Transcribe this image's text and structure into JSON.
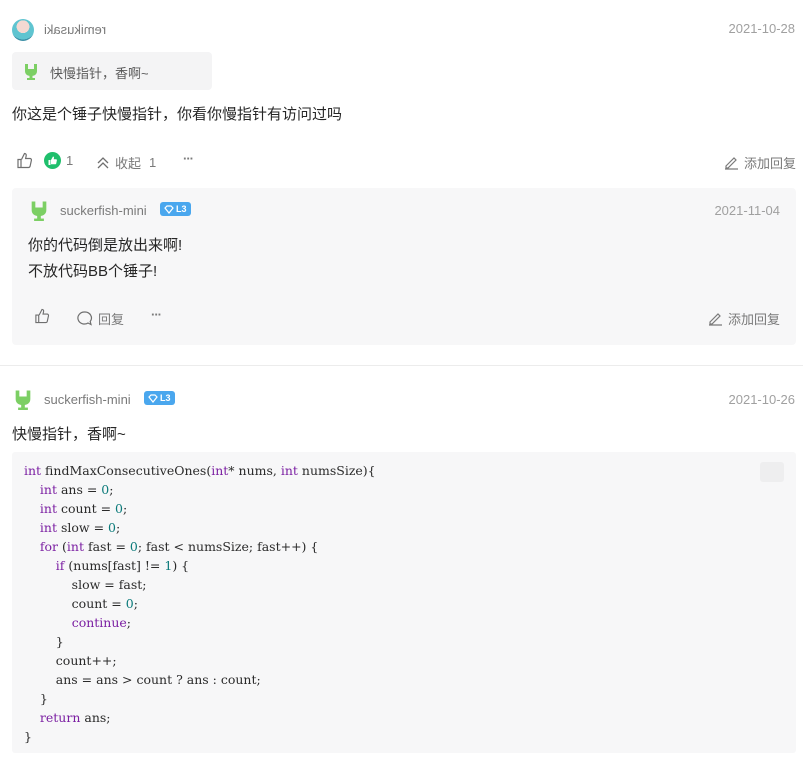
{
  "comment1": {
    "username": "remikusaki",
    "date": "2021-10-28",
    "quote_text": "快慢指针，香啊~",
    "body": "你这是个锤子快慢指针，你看你慢指针有访问过吗",
    "like_count": "1",
    "collapse_label": "收起",
    "collapse_count": "1",
    "more_label": "···",
    "add_reply_label": "添加回复"
  },
  "reply1": {
    "username": "suckerfish-mini",
    "level": "L3",
    "date": "2021-11-04",
    "line1": "你的代码倒是放出来啊!",
    "line2": "不放代码BB个锤子!",
    "reply_label": "回复",
    "more_label": "···",
    "add_reply_label": "添加回复"
  },
  "comment2": {
    "username": "suckerfish-mini",
    "level": "L3",
    "date": "2021-10-26",
    "body": "快慢指针，香啊~",
    "code_lines": [
      [
        {
          "t": "int",
          "c": "kw"
        },
        {
          "t": " findMaxConsecutiveOnes("
        },
        {
          "t": "int",
          "c": "kw"
        },
        {
          "t": "* nums, "
        },
        {
          "t": "int",
          "c": "kw"
        },
        {
          "t": " numsSize){"
        }
      ],
      [
        {
          "t": "    "
        },
        {
          "t": "int",
          "c": "kw"
        },
        {
          "t": " ans = "
        },
        {
          "t": "0",
          "c": "num"
        },
        {
          "t": ";"
        }
      ],
      [
        {
          "t": "    "
        },
        {
          "t": "int",
          "c": "kw"
        },
        {
          "t": " count = "
        },
        {
          "t": "0",
          "c": "num"
        },
        {
          "t": ";"
        }
      ],
      [
        {
          "t": "    "
        },
        {
          "t": "int",
          "c": "kw"
        },
        {
          "t": " slow = "
        },
        {
          "t": "0",
          "c": "num"
        },
        {
          "t": ";"
        }
      ],
      [
        {
          "t": "    "
        },
        {
          "t": "for",
          "c": "kw"
        },
        {
          "t": " ("
        },
        {
          "t": "int",
          "c": "kw"
        },
        {
          "t": " fast = "
        },
        {
          "t": "0",
          "c": "num"
        },
        {
          "t": "; fast < numsSize; fast++) {"
        }
      ],
      [
        {
          "t": "        "
        },
        {
          "t": "if",
          "c": "kw"
        },
        {
          "t": " (nums[fast] != "
        },
        {
          "t": "1",
          "c": "num"
        },
        {
          "t": ") {"
        }
      ],
      [
        {
          "t": "            slow = fast;"
        }
      ],
      [
        {
          "t": "            count = "
        },
        {
          "t": "0",
          "c": "num"
        },
        {
          "t": ";"
        }
      ],
      [
        {
          "t": "            "
        },
        {
          "t": "continue",
          "c": "kw"
        },
        {
          "t": ";"
        }
      ],
      [
        {
          "t": "        }"
        }
      ],
      [
        {
          "t": "        count++;"
        }
      ],
      [
        {
          "t": "        ans = ans > count ? ans : count;"
        }
      ],
      [
        {
          "t": "    }"
        }
      ],
      [
        {
          "t": "    "
        },
        {
          "t": "return",
          "c": "kw"
        },
        {
          "t": " ans;"
        }
      ],
      [
        {
          "t": "}"
        }
      ]
    ]
  },
  "colors": {
    "like_active": "#1fbf6c",
    "badge": "#4aa7ee",
    "android": "#7ccf64",
    "keyword": "#7b1fa2",
    "number": "#0b7a7a"
  }
}
